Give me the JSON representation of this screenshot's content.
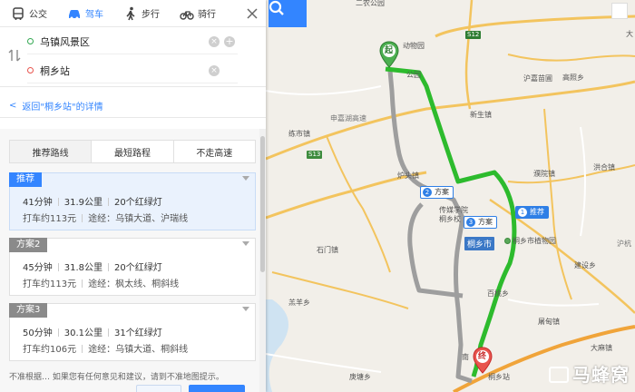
{
  "modes": [
    {
      "label": "公交",
      "icon": "bus-icon"
    },
    {
      "label": "驾车",
      "icon": "car-icon",
      "active": true
    },
    {
      "label": "步行",
      "icon": "walk-icon"
    },
    {
      "label": "骑行",
      "icon": "bike-icon"
    }
  ],
  "route": {
    "start_value": "乌镇风景区",
    "end_value": "桐乡站"
  },
  "back_link": "返回\"桐乡站\"的详情",
  "tabs": [
    "推荐路线",
    "最短路程",
    "不走高速"
  ],
  "plans": [
    {
      "badge": "推荐",
      "time": "41分钟",
      "distance": "31.9公里",
      "lights": "20个红绿灯",
      "taxi": "打车约113元",
      "via": "途经：乌镇大道、沪瑞线"
    },
    {
      "badge": "方案2",
      "time": "45分钟",
      "distance": "31.8公里",
      "lights": "20个红绿灯",
      "taxi": "打车约113元",
      "via": "途经：枫太线、桐斜线"
    },
    {
      "badge": "方案3",
      "time": "50分钟",
      "distance": "30.1公里",
      "lights": "31个红绿灯",
      "taxi": "打车约106元",
      "via": "途经：乌镇大道、桐斜线"
    }
  ],
  "footer_note": "不准根据… 如果您有任何意见和建议，请到不准地图提示。",
  "map": {
    "start_marker": "起",
    "end_marker": "终",
    "route_tags": [
      {
        "num": "1",
        "label": "推荐"
      },
      {
        "num": "2",
        "label": "方案"
      },
      {
        "num": "3",
        "label": "方案"
      }
    ],
    "city_tag": "桐乡市",
    "logo": "马蜂窝",
    "labels": {
      "l1": "二农公园",
      "l2": "动物园",
      "l3": "公园",
      "l4": "S12",
      "l5": "沪嘉苗圃",
      "l6": "高照乡",
      "l7": "大",
      "l8": "申嘉湖高速",
      "l9": "新生镇",
      "l10": "练市镇",
      "l11": "S13",
      "l12": "炉头镇",
      "l13": "濮院镇",
      "l14": "洪合镇",
      "l15": "传媒学院",
      "l16": "桐乡校",
      "l17": "桐乡市植物园",
      "l18": "石门镇",
      "l19": "建设乡",
      "l20": "羔羊乡",
      "l21": "百桃乡",
      "l22": "屠甸镇",
      "l23": "大麻镇",
      "l24": "庚塘乡",
      "l25": "桐乡站",
      "l26": "南",
      "l27": "沪杭"
    }
  }
}
